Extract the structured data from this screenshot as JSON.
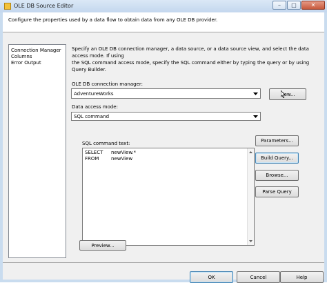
{
  "window": {
    "title": "OLE DB Source Editor"
  },
  "header": {
    "description": "Configure the properties used by a data flow to obtain data from any OLE DB provider."
  },
  "nav": {
    "items": [
      "Connection Manager",
      "Columns",
      "Error Output"
    ]
  },
  "main": {
    "description_lines": [
      "Specify an OLE DB connection manager, a data source, or a data source view, and select the data access mode. If using",
      "the SQL command access mode, specify the SQL command either by typing the query or by using Query Builder."
    ],
    "connection_manager": {
      "label": "OLE DB connection manager:",
      "value": "AdventureWorks",
      "new_button": "New..."
    },
    "access_mode": {
      "label": "Data access mode:",
      "value": "SQL command"
    },
    "sql": {
      "label": "SQL command text:",
      "lines": [
        {
          "keyword": "SELECT",
          "text": "newView.*"
        },
        {
          "keyword": "FROM",
          "text": "newView"
        }
      ]
    },
    "buttons": {
      "parameters": "Parameters...",
      "build_query": "Build Query...",
      "browse": "Browse...",
      "parse_query": "Parse Query",
      "preview": "Preview..."
    }
  },
  "footer": {
    "ok": "OK",
    "cancel": "Cancel",
    "help": "Help"
  },
  "icons": {
    "app": "ssis-source-icon",
    "dropdown": "chevron-down-icon",
    "close": "close-icon"
  },
  "colors": {
    "title_bar": "#c3d7ee",
    "close_button": "#c75a3d",
    "dialog_background": "#f0f0f0",
    "default_button_border": "#3c7fb1"
  }
}
